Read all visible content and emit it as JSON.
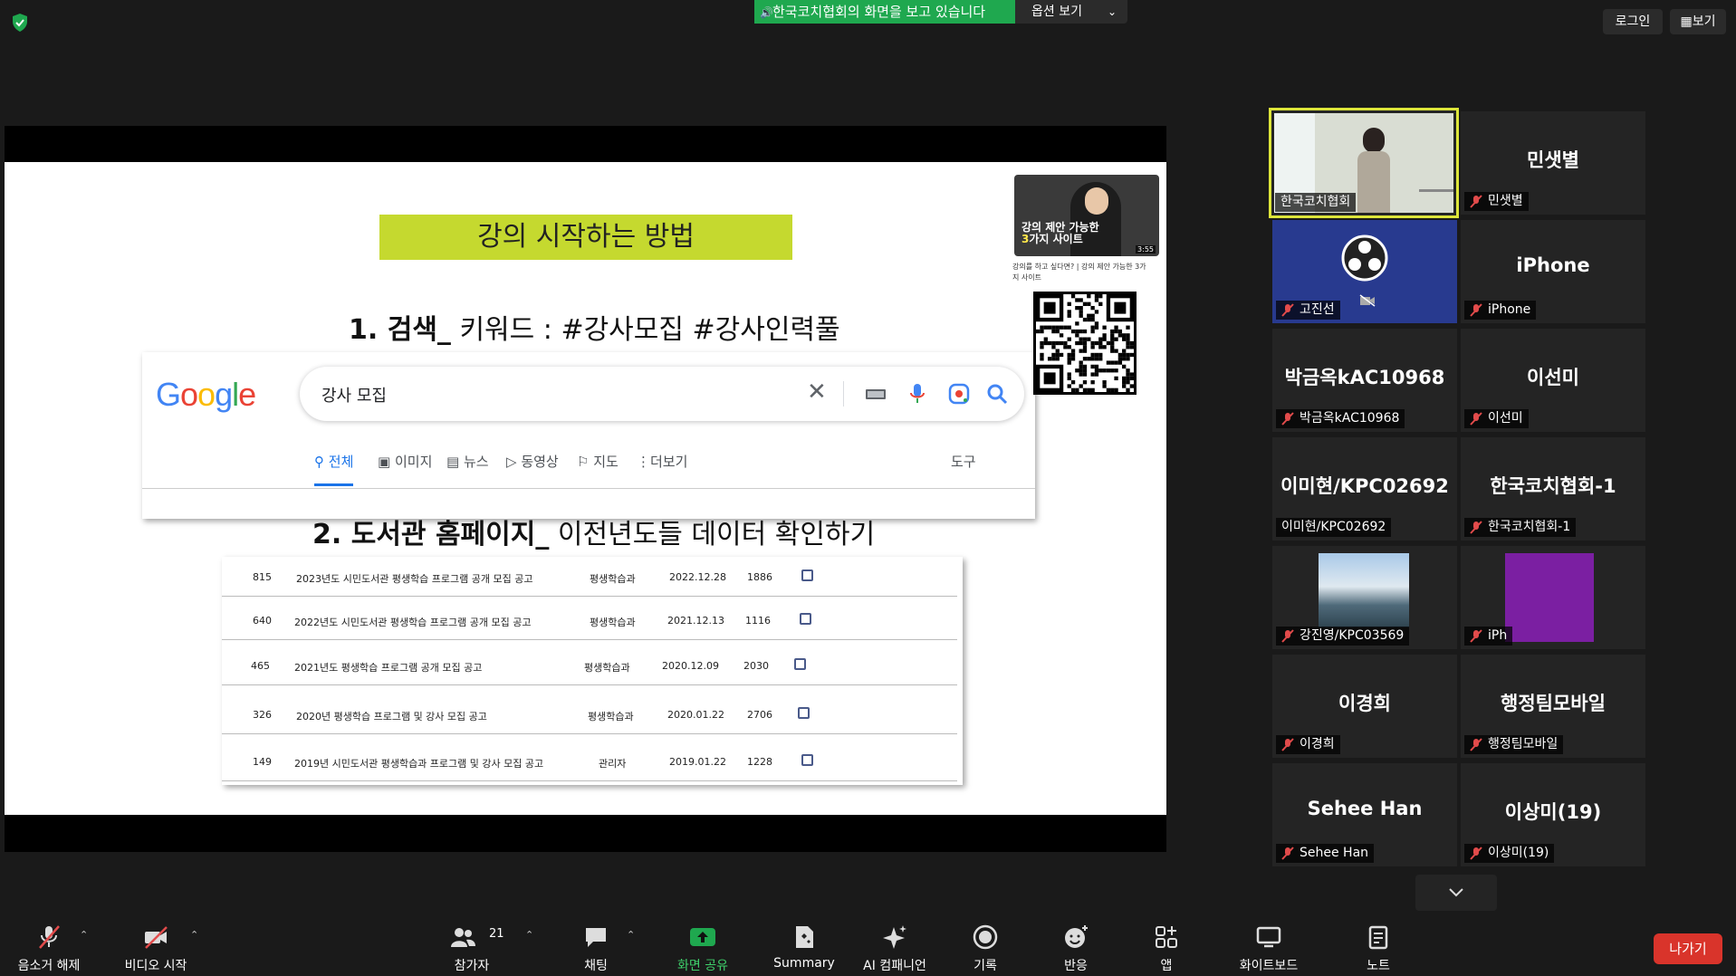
{
  "topbar": {
    "share_banner": "한국코치협회의 화면을 보고 있습니다",
    "options_label": "옵션 보기",
    "login_label": "로그인",
    "view_label": "보기"
  },
  "slide": {
    "title": "강의 시작하는 방법",
    "heading1_bold": "1. 검색_",
    "heading1_rest": " 키워드 : #강사모집  #강사인력풀",
    "heading2_bold": "2. 도서관 홈페이지_",
    "heading2_rest": " 이전년도들 데이터 확인하기",
    "google": {
      "logo": [
        "G",
        "o",
        "o",
        "g",
        "l",
        "e"
      ],
      "query": "강사 모집",
      "tabs": [
        "전체",
        "이미지",
        "뉴스",
        "동영상",
        "지도",
        "더보기",
        "도구"
      ]
    },
    "table": [
      {
        "no": "815",
        "title": "2023년도 시민도서관 평생학습 프로그램 공개 모집 공고",
        "dept": "평생학습과",
        "date": "2022.12.28",
        "views": "1886"
      },
      {
        "no": "640",
        "title": "2022년도 시민도서관 평생학습 프로그램 공개 모집 공고",
        "dept": "평생학습과",
        "date": "2021.12.13",
        "views": "1116"
      },
      {
        "no": "465",
        "title": "2021년도 평생학습 프로그램 공개 모집 공고",
        "dept": "평생학습과",
        "date": "2020.12.09",
        "views": "2030"
      },
      {
        "no": "326",
        "title": "2020년 평생학습 프로그램 및 강사 모집 공고",
        "dept": "평생학습과",
        "date": "2020.01.22",
        "views": "2706"
      },
      {
        "no": "149",
        "title": "2019년 시민도서관 평생학습과 프로그램 및 강사 모집 공고",
        "dept": "관리자",
        "date": "2019.01.22",
        "views": "1228"
      }
    ],
    "thumbnail": {
      "line1": "강의 제안 가능한",
      "line2_accent": "3",
      "line2_rest": "가지 사이트",
      "duration": "3:55",
      "caption": "강의를 하고 싶다면? | 강의 제안 가능한 3가지 사이트"
    }
  },
  "participants": [
    {
      "big": "",
      "name": "한국코치협회",
      "kind": "video-speaker",
      "muted": false
    },
    {
      "big": "민샛별",
      "name": "민샛별",
      "kind": "text",
      "muted": true
    },
    {
      "big": "",
      "name": "고진선",
      "kind": "obs",
      "muted": true
    },
    {
      "big": "iPhone",
      "name": "iPhone",
      "kind": "text",
      "muted": true
    },
    {
      "big": "박금옥kAC10968",
      "name": "박금옥kAC10968",
      "kind": "text",
      "muted": true
    },
    {
      "big": "이선미",
      "name": "이선미",
      "kind": "text",
      "muted": true
    },
    {
      "big": "이미현/KPC02692",
      "name": "이미현/KPC02692",
      "kind": "text",
      "muted": false
    },
    {
      "big": "한국코치협회-1",
      "name": "한국코치협회-1",
      "kind": "text",
      "muted": true
    },
    {
      "big": "",
      "name": "강진영/KPC03569",
      "kind": "photo-bridge",
      "muted": true
    },
    {
      "big": "",
      "name": "iPh",
      "kind": "photo-purple",
      "muted": true
    },
    {
      "big": "이경희",
      "name": "이경희",
      "kind": "text",
      "muted": true
    },
    {
      "big": "행정팀모바일",
      "name": "행정팀모바일",
      "kind": "text",
      "muted": true
    },
    {
      "big": "Sehee Han",
      "name": "Sehee Han",
      "kind": "text",
      "muted": true
    },
    {
      "big": "이상미(19)",
      "name": "이상미(19)",
      "kind": "text",
      "muted": true
    }
  ],
  "toolbar": {
    "unmute": "음소거 해제",
    "video": "비디오 시작",
    "participants": "참가자",
    "participants_count": "21",
    "chat": "채팅",
    "share": "화면 공유",
    "summary": "Summary",
    "ai": "AI 컴패니언",
    "record": "기록",
    "reactions": "반응",
    "apps": "앱",
    "whiteboard": "화이트보드",
    "notes": "노트",
    "leave": "나가기"
  },
  "colors": {
    "share_green": "#1fa84f",
    "slide_title_bg": "#c5d92f",
    "active_speaker_border": "#dde53a",
    "mute_red": "#e24b4b",
    "leave_red": "#d9342b"
  }
}
